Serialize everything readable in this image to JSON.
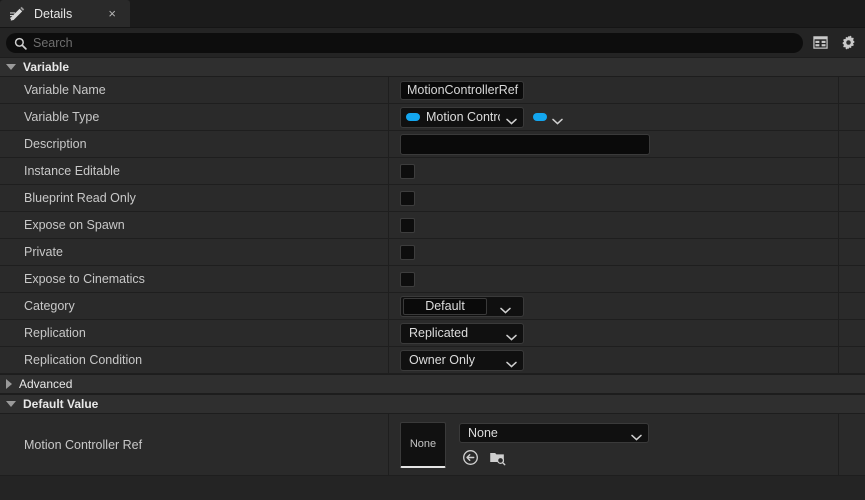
{
  "tab": {
    "label": "Details",
    "icon": "details-pencil-icon",
    "close_label": "×"
  },
  "toolbar": {
    "search_placeholder": "Search",
    "search_icon": "search-icon",
    "columns_icon": "columns-grid-icon",
    "settings_icon": "gear-icon"
  },
  "sections": {
    "variable": {
      "title": "Variable",
      "expanded": true
    },
    "advanced": {
      "title": "Advanced",
      "expanded": false
    },
    "default_value": {
      "title": "Default Value",
      "expanded": true
    }
  },
  "rows": {
    "variable_name": {
      "label": "Variable Name",
      "value": "MotionControllerRef"
    },
    "variable_type": {
      "label": "Variable Type",
      "value": "Motion Contro"
    },
    "description": {
      "label": "Description",
      "value": ""
    },
    "instance_editable": {
      "label": "Instance Editable",
      "checked": false
    },
    "blueprint_read_only": {
      "label": "Blueprint Read Only",
      "checked": false
    },
    "expose_on_spawn": {
      "label": "Expose on Spawn",
      "checked": false
    },
    "private": {
      "label": "Private",
      "checked": false
    },
    "expose_to_cinematics": {
      "label": "Expose to Cinematics",
      "checked": false
    },
    "category": {
      "label": "Category",
      "value": "Default"
    },
    "replication": {
      "label": "Replication",
      "value": "Replicated"
    },
    "replication_condition": {
      "label": "Replication Condition",
      "value": "Owner Only"
    },
    "motion_controller_ref": {
      "label": "Motion Controller Ref",
      "thumbnail_text": "None",
      "value": "None",
      "use_selected_icon": "use-selected-asset-icon",
      "browse_icon": "browse-asset-icon"
    }
  },
  "colors": {
    "accent_pin_blue": "#13a6ef",
    "panel_bg": "#2a2a2a",
    "section_header_bg": "#2f2f2f",
    "field_bg": "#0a0a0a"
  }
}
